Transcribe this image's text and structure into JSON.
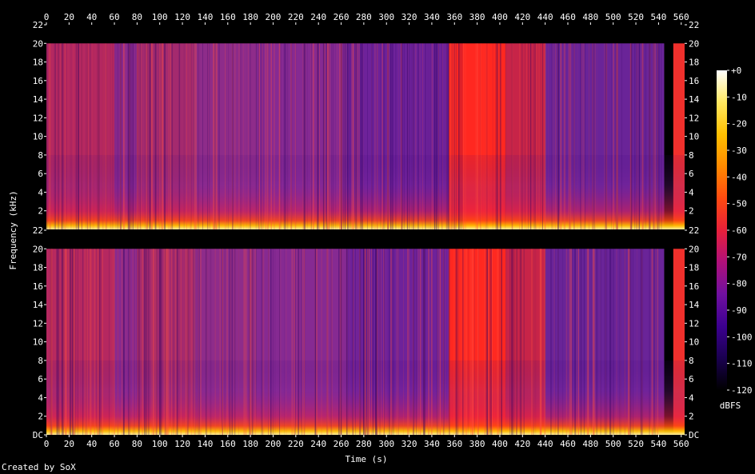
{
  "chart_data": {
    "type": "heatmap",
    "title": "",
    "xlabel": "Time (s)",
    "ylabel": "Frequency (kHz)",
    "x_ticks": [
      0,
      20,
      40,
      60,
      80,
      100,
      120,
      140,
      160,
      180,
      200,
      220,
      240,
      260,
      280,
      300,
      320,
      340,
      360,
      380,
      400,
      420,
      440,
      460,
      480,
      500,
      520,
      540,
      560
    ],
    "xlim": [
      0,
      563
    ],
    "y_ticks": [
      "DC",
      "2",
      "4",
      "6",
      "8",
      "10",
      "12",
      "14",
      "16",
      "18",
      "20",
      "22"
    ],
    "y_tick_values_khz": [
      0,
      2,
      4,
      6,
      8,
      10,
      12,
      14,
      16,
      18,
      20,
      22
    ],
    "ylim_khz": [
      0,
      22
    ],
    "channels": [
      "channel-1",
      "channel-2"
    ],
    "colorbar": {
      "label": "dBFS",
      "ticks": [
        "+0",
        "-10",
        "-20",
        "-30",
        "-40",
        "-50",
        "-60",
        "-70",
        "-80",
        "-90",
        "-100",
        "-110",
        "-120"
      ],
      "tick_values": [
        0,
        -10,
        -20,
        -30,
        -40,
        -50,
        -60,
        -70,
        -80,
        -90,
        -100,
        -110,
        -120
      ],
      "range": [
        -120,
        0
      ],
      "colors": [
        "#000000",
        "#1a0050",
        "#3c0090",
        "#7010a0",
        "#b0107a",
        "#e8203a",
        "#ff4a10",
        "#ff8a00",
        "#ffc000",
        "#ffe860",
        "#ffffff"
      ]
    },
    "content_cutoff_khz": 20,
    "segments": [
      {
        "start": 0,
        "end": 60,
        "level": 0.42,
        "color": "#b52860"
      },
      {
        "start": 60,
        "end": 80,
        "level": 0.34,
        "color": "#8a2a8e"
      },
      {
        "start": 80,
        "end": 130,
        "level": 0.4,
        "color": "#a42a6e"
      },
      {
        "start": 130,
        "end": 185,
        "level": 0.36,
        "color": "#8e2c8a"
      },
      {
        "start": 185,
        "end": 265,
        "level": 0.34,
        "color": "#862a92"
      },
      {
        "start": 265,
        "end": 355,
        "level": 0.3,
        "color": "#6e229a"
      },
      {
        "start": 355,
        "end": 405,
        "level": 0.95,
        "color": "#ff2820"
      },
      {
        "start": 405,
        "end": 440,
        "level": 0.55,
        "color": "#c72448"
      },
      {
        "start": 440,
        "end": 545,
        "level": 0.3,
        "color": "#6a2498"
      },
      {
        "start": 545,
        "end": 553,
        "level": 0.05,
        "color": "#000000"
      },
      {
        "start": 553,
        "end": 563,
        "level": 0.85,
        "color": "#f0302c"
      }
    ],
    "credit": "Created by SoX"
  }
}
